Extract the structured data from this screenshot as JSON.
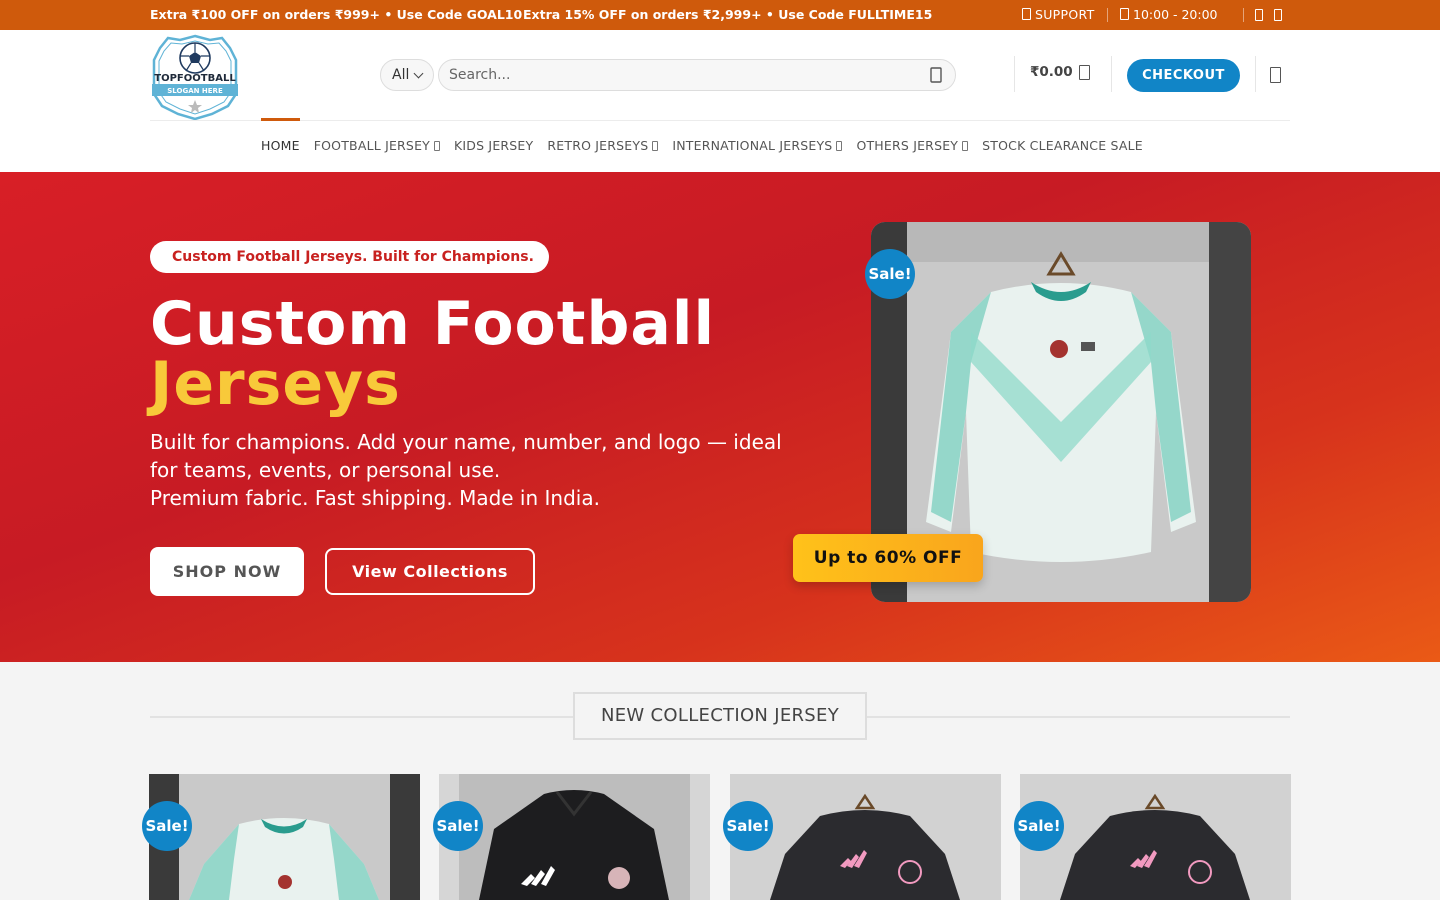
{
  "topbar": {
    "promo1": "Extra ₹100 OFF on orders ₹999+ • Use Code GOAL10",
    "promo2": "Extra 15% OFF on orders ₹2,999+ • Use Code FULLTIME15",
    "support_label": "SUPPORT",
    "hours": "10:00 - 20:00",
    "background": "#cf5a0c"
  },
  "header": {
    "logo_text": "TOPFOOTBALL",
    "logo_slogan": "SLOGAN HERE",
    "category_selected": "All",
    "search_placeholder": "Search...",
    "cart_total": "₹0.00",
    "checkout_label": "CHECKOUT",
    "accent": "#1185c7"
  },
  "nav": {
    "items": [
      {
        "label": "HOME",
        "active": true,
        "dropdown": false
      },
      {
        "label": "FOOTBALL JERSEY",
        "active": false,
        "dropdown": true
      },
      {
        "label": "KIDS JERSEY",
        "active": false,
        "dropdown": false
      },
      {
        "label": "RETRO JERSEYS",
        "active": false,
        "dropdown": true
      },
      {
        "label": "INTERNATIONAL JERSEYS",
        "active": false,
        "dropdown": true
      },
      {
        "label": "OTHERS JERSEY",
        "active": false,
        "dropdown": true
      },
      {
        "label": "STOCK CLEARANCE SALE",
        "active": false,
        "dropdown": false
      }
    ]
  },
  "hero": {
    "tagline": "Custom Football Jerseys. Built for Champions.",
    "title_line1": "Custom Football",
    "title_line2": "Jerseys",
    "desc_line1": "Built for champions. Add your name, number, and logo — ideal for teams, events, or personal use.",
    "desc_line2": "Premium fabric. Fast shipping. Made in India.",
    "btn_shop": "SHOP NOW",
    "btn_collections": "View Collections",
    "sale_badge": "Sale!",
    "off_badge": "Up to 60% OFF",
    "title_highlight_color": "#f8c93a"
  },
  "collection": {
    "title": "NEW COLLECTION JERSEY",
    "products": [
      {
        "badge": "Sale!",
        "image": "mint-longsleeve-jersey"
      },
      {
        "badge": "Sale!",
        "image": "black-polo-jersey"
      },
      {
        "badge": "Sale!",
        "image": "black-pink-jersey"
      },
      {
        "badge": "Sale!",
        "image": "black-pink-jersey"
      }
    ]
  }
}
